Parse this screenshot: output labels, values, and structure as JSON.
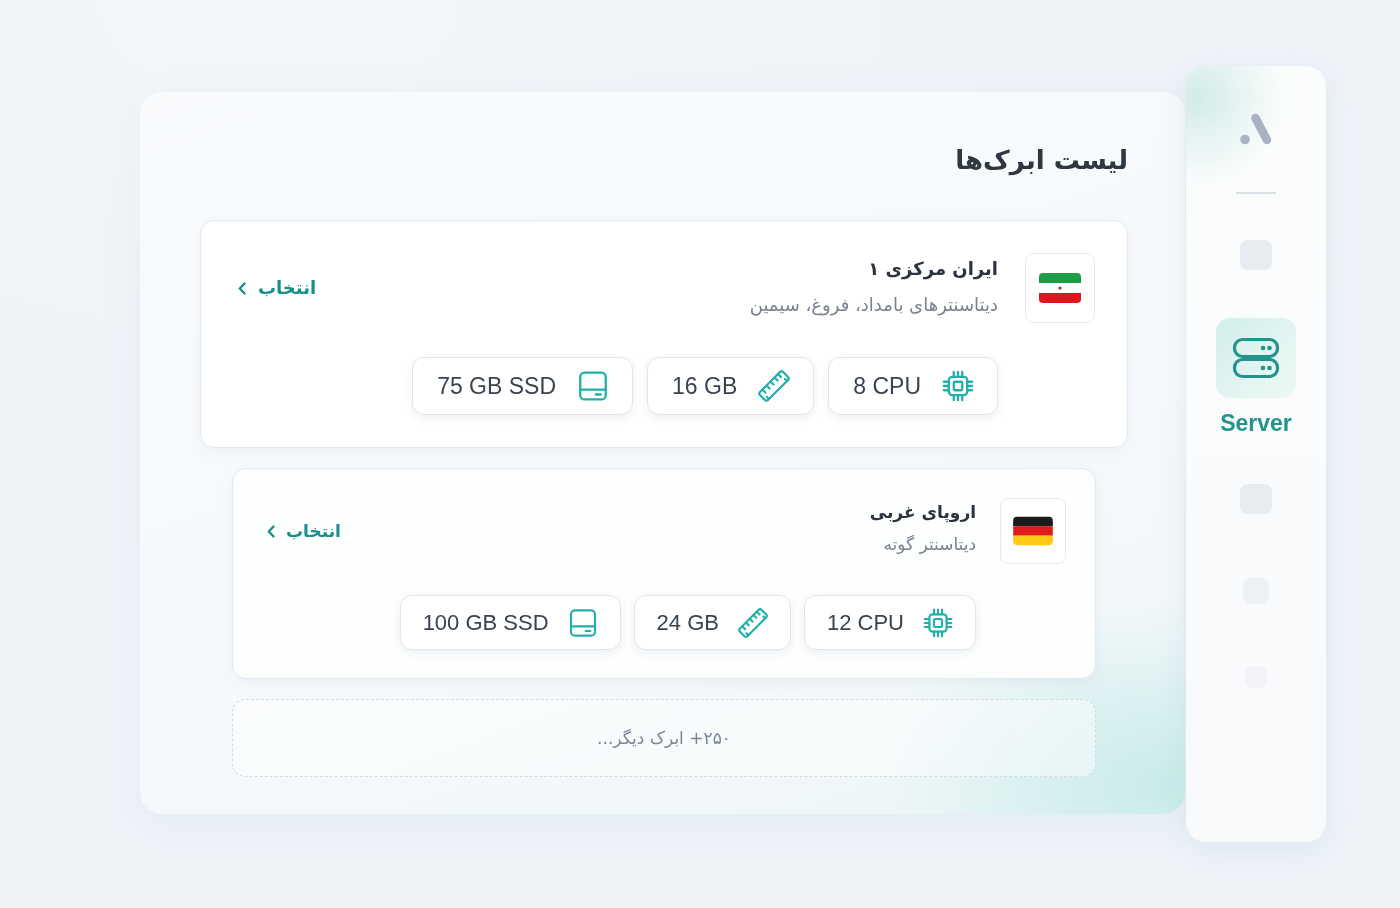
{
  "title": "لیست ابرک‌ها",
  "regions": [
    {
      "name": "ایران مرکزی ۱",
      "datacenters": "دیتاسنترهای بامداد، فروغ، سیمین",
      "kind": "iran",
      "action": "انتخاب",
      "specs": [
        {
          "kind": "cpu",
          "text": "8 CPU"
        },
        {
          "kind": "ram",
          "text": "16 GB"
        },
        {
          "kind": "disk",
          "text": "75 GB SSD"
        }
      ]
    },
    {
      "name": "اروپای غربی",
      "datacenters": "دیتاسنتر گوته",
      "kind": "germany",
      "action": "انتخاب",
      "specs": [
        {
          "kind": "cpu",
          "text": "12 CPU"
        },
        {
          "kind": "ram",
          "text": "24 GB"
        },
        {
          "kind": "disk",
          "text": "100 GB SSD"
        }
      ]
    }
  ],
  "more": "۲۵۰+ ابرک دیگر...",
  "sidebar": {
    "items": [
      {
        "selected": false
      },
      {
        "selected": true,
        "label": "Server"
      },
      {
        "selected": false
      },
      {
        "selected": false
      },
      {
        "selected": false
      }
    ]
  }
}
